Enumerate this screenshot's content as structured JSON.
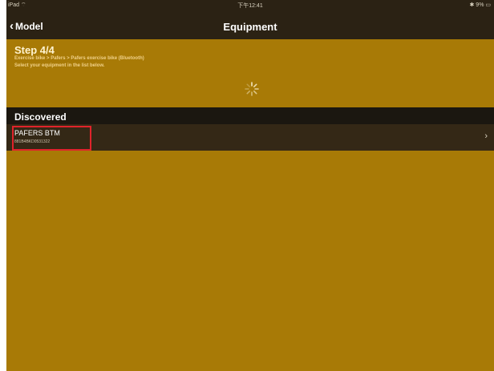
{
  "status_bar": {
    "carrier": "iPad",
    "wifi_icon": "wifi-icon",
    "time": "下午12:41",
    "battery_text": "9%",
    "battery_icon": "battery-icon"
  },
  "nav": {
    "back_label": "Model",
    "title": "Equipment"
  },
  "step": {
    "title": "Step 4/4",
    "path": "Exercise bike > Pafers > Pafers exercise bike (Bluetooth)",
    "instruction": "Select your equipment in the list below."
  },
  "section": {
    "title": "Discovered"
  },
  "devices": [
    {
      "name": "PAFERS BTM",
      "address": "881B4BKD0531322"
    }
  ],
  "colors": {
    "accent": "#a87a06",
    "bar_dark": "#2b2214",
    "highlight": "#e0232b"
  }
}
